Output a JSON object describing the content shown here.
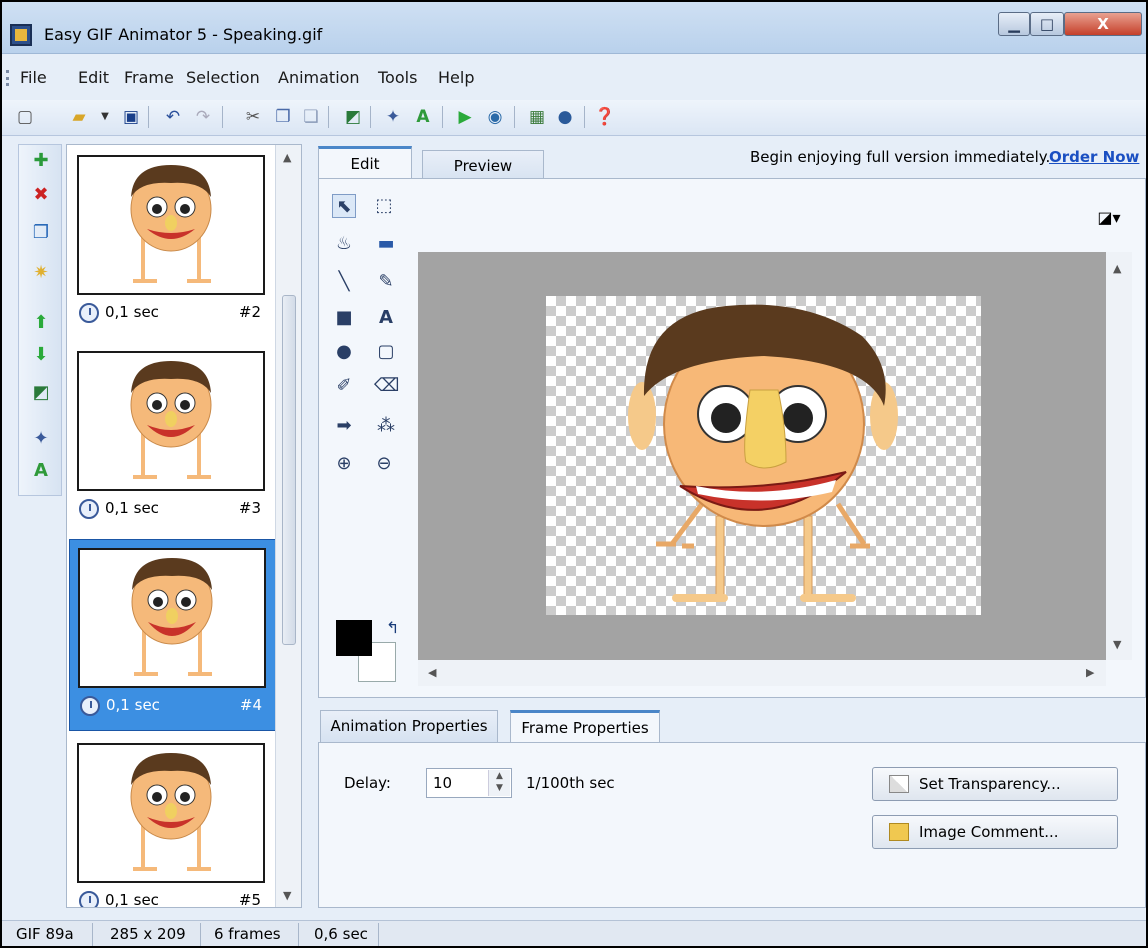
{
  "window": {
    "title": "Easy GIF Animator 5 - Speaking.gif",
    "controls": {
      "minimize": "▁",
      "maximize": "□",
      "close": "X"
    }
  },
  "menu": [
    "File",
    "Edit",
    "Frame",
    "Selection",
    "Animation",
    "Tools",
    "Help"
  ],
  "toolbar": {
    "icons": [
      "new-icon",
      "open-icon",
      "dropdown-icon",
      "save-icon",
      "undo-icon",
      "redo-icon",
      "cut-icon",
      "copy-icon",
      "paste-icon",
      "resize-icon",
      "wizard-icon",
      "text-icon",
      "play-icon",
      "preview-browser-icon",
      "export-icon",
      "zoom-icon",
      "help-icon"
    ]
  },
  "left_tools": {
    "icons": [
      "add-frame-icon",
      "delete-frame-icon",
      "duplicate-frame-icon",
      "insert-frame-icon",
      "move-up-icon",
      "move-down-icon",
      "resize-icon",
      "effects-icon",
      "text-banner-icon"
    ]
  },
  "frames": [
    {
      "delay": "0,1 sec",
      "number": "#2",
      "selected": false
    },
    {
      "delay": "0,1 sec",
      "number": "#3",
      "selected": false
    },
    {
      "delay": "0,1 sec",
      "number": "#4",
      "selected": true
    },
    {
      "delay": "0,1 sec",
      "number": "#5",
      "selected": false
    }
  ],
  "tabs": {
    "edit": "Edit",
    "preview": "Preview"
  },
  "promo": {
    "text": "Begin enjoying full version immediately.",
    "link": "Order Now"
  },
  "edit_tools": [
    "pointer-icon",
    "rect-select-icon",
    "fill-icon",
    "gradient-icon",
    "line-icon",
    "brush-icon",
    "rectangle-icon",
    "text-tool-icon",
    "ellipse-icon",
    "rounded-rect-icon",
    "eyedropper-icon",
    "eraser-icon",
    "import-icon",
    "spray-icon",
    "zoom-in-icon",
    "zoom-out-icon"
  ],
  "properties": {
    "tabs": {
      "animation": "Animation Properties",
      "frame": "Frame Properties"
    },
    "delay_label": "Delay:",
    "delay_value": "10",
    "delay_unit": "1/100th sec",
    "set_transparency": "Set Transparency...",
    "image_comment": "Image Comment..."
  },
  "status": {
    "format": "GIF 89a",
    "size": "285 x 209",
    "frames": "6 frames",
    "duration": "0,6 sec"
  },
  "colors": {
    "accent": "#3c8fe2",
    "link": "#1a4fc2",
    "canvas_bg": "#a3a3a3",
    "hair": "#5a3a1e",
    "skin": "#f5b97a"
  }
}
